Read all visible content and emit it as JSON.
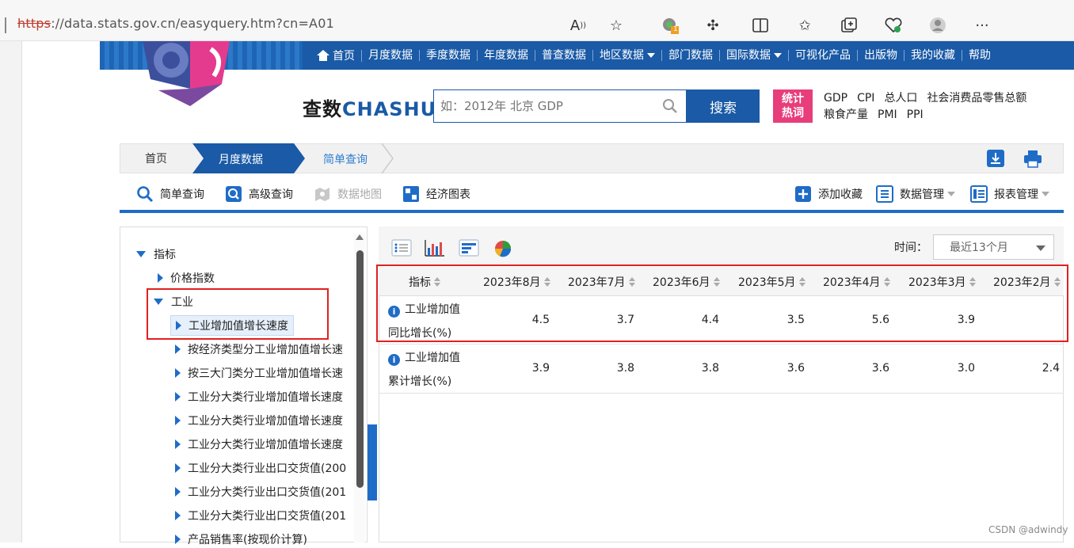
{
  "browser": {
    "url_scheme": "https",
    "url_rest": "://data.stats.gov.cn/easyquery.htm?cn=A01",
    "extension_badge": "1"
  },
  "site": {
    "nav": [
      {
        "label": "首页",
        "caret": false
      },
      {
        "label": "月度数据",
        "caret": false
      },
      {
        "label": "季度数据",
        "caret": false
      },
      {
        "label": "年度数据",
        "caret": false
      },
      {
        "label": "普查数据",
        "caret": false
      },
      {
        "label": "地区数据",
        "caret": true
      },
      {
        "label": "部门数据",
        "caret": false
      },
      {
        "label": "国际数据",
        "caret": true
      },
      {
        "label": "可视化产品",
        "caret": false
      },
      {
        "label": "出版物",
        "caret": false
      },
      {
        "label": "我的收藏",
        "caret": false
      },
      {
        "label": "帮助",
        "caret": false
      }
    ],
    "brand_cn": "查数",
    "brand_en": "CHASHU",
    "search_placeholder": "如：2012年 北京 GDP",
    "search_button": "搜索",
    "hot_badge_line1": "统计",
    "hot_badge_line2": "热词",
    "hot_words_row1": [
      "GDP",
      "CPI",
      "总人口",
      "社会消费品零售总额"
    ],
    "hot_words_row2": [
      "粮食产量",
      "PMI",
      "PPI"
    ]
  },
  "breadcrumb": {
    "home": "首页",
    "month": "月度数据",
    "current": "简单查询"
  },
  "query_bar": {
    "simple": "简单查询",
    "advanced": "高级查询",
    "map": "数据地图",
    "charts": "经济图表",
    "add_fav": "添加收藏",
    "data_mgmt": "数据管理",
    "report_mgmt": "报表管理"
  },
  "tree": {
    "root": "指标",
    "price": "价格指数",
    "industry": "工业",
    "selected": "工业增加值增长速度",
    "children": [
      "按经济类型分工业增加值增长速",
      "按三大门类分工业增加值增长速",
      "工业分大类行业增加值增长速度",
      "工业分大类行业增加值增长速度",
      "工业分大类行业增加值增长速度",
      "工业分大类行业出口交货值(200",
      "工业分大类行业出口交货值(201",
      "工业分大类行业出口交货值(201",
      "产品销售率(按现价计算)"
    ]
  },
  "data_panel": {
    "time_label": "时间：",
    "time_value": "最近13个月",
    "header_indicator": "指标",
    "months": [
      "2023年8月",
      "2023年7月",
      "2023年6月",
      "2023年5月",
      "2023年4月",
      "2023年3月",
      "2023年2月"
    ],
    "rows": [
      {
        "name_line1": "工业增加值",
        "name_line2": "同比增长(%)",
        "values": [
          "4.5",
          "3.7",
          "4.4",
          "3.5",
          "5.6",
          "3.9",
          ""
        ]
      },
      {
        "name_line1": "工业增加值",
        "name_line2": "累计增长(%)",
        "values": [
          "3.9",
          "3.8",
          "3.8",
          "3.6",
          "3.6",
          "3.0",
          "2.4"
        ]
      }
    ]
  },
  "watermark": "CSDN @adwindy",
  "colors": {
    "nav_blue": "#1a5aa6",
    "accent_blue": "#1f6cc7",
    "hot_pink": "#e83d7b",
    "annotation_red": "#e02020"
  }
}
